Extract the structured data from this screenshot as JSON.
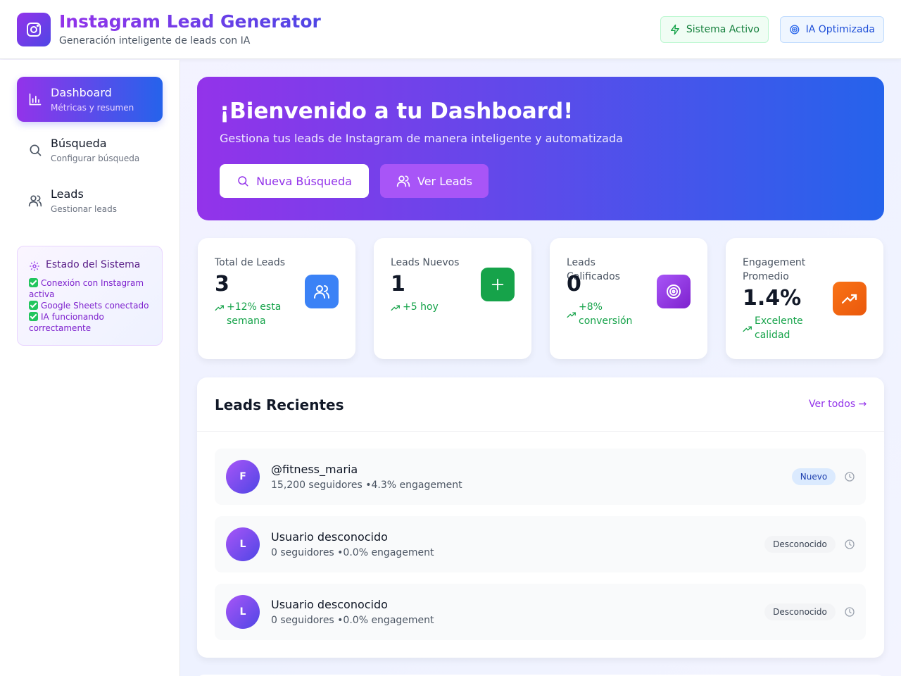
{
  "header": {
    "title": "Instagram Lead Generator",
    "subtitle": "Generación inteligente de leads con IA",
    "status_pills": [
      {
        "label": "Sistema Activo",
        "icon": "lightning-icon"
      },
      {
        "label": "IA Optimizada",
        "icon": "target-icon"
      }
    ]
  },
  "sidebar": {
    "items": [
      {
        "label": "Dashboard",
        "description": "Métricas y resumen",
        "icon": "bar-chart-icon",
        "active": true
      },
      {
        "label": "Búsqueda",
        "description": "Configurar búsqueda",
        "icon": "search-icon",
        "active": false
      },
      {
        "label": "Leads",
        "description": "Gestionar leads",
        "icon": "users-icon",
        "active": false
      }
    ],
    "system_status": {
      "title": "Estado del Sistema",
      "lines": [
        "Conexión con Instagram activa",
        "Google Sheets conectado",
        "IA funcionando correctamente"
      ]
    }
  },
  "hero": {
    "title": "¡Bienvenido a tu Dashboard!",
    "subtitle": "Gestiona tus leads de Instagram de manera inteligente y automatizada",
    "primary_button": "Nueva Búsqueda",
    "secondary_button": "Ver Leads"
  },
  "stats": [
    {
      "label": "Total de Leads",
      "value": "3",
      "trend": "+12% esta semana",
      "icon": "users-icon",
      "color": "#3b82f6"
    },
    {
      "label": "Leads Nuevos",
      "value": "1",
      "trend": "+5 hoy",
      "icon": "plus-icon",
      "color": "#16a34a"
    },
    {
      "label": "Leads Calificados",
      "value": "0",
      "trend": "+8% conversión",
      "icon": "target-icon",
      "color": "#a855f7"
    },
    {
      "label": "Engagement Promedio",
      "value": "1.4%",
      "trend": "Excelente calidad",
      "icon": "trending-up-icon",
      "color": "#f97316"
    }
  ],
  "recent_leads": {
    "title": "Leads Recientes",
    "view_all": "Ver todos →",
    "items": [
      {
        "initial": "F",
        "username": "@fitness_maria",
        "meta": "15,200 seguidores •4.3% engagement",
        "status": "Nuevo"
      },
      {
        "initial": "L",
        "username": "Usuario desconocido",
        "meta": "0 seguidores •0.0% engagement",
        "status": "Desconocido"
      },
      {
        "initial": "L",
        "username": "Usuario desconocido",
        "meta": "0 seguidores •0.0% engagement",
        "status": "Desconocido"
      }
    ]
  },
  "colors": {
    "accent_purple": "#9333ea",
    "accent_blue": "#2563eb",
    "success": "#16a34a"
  }
}
